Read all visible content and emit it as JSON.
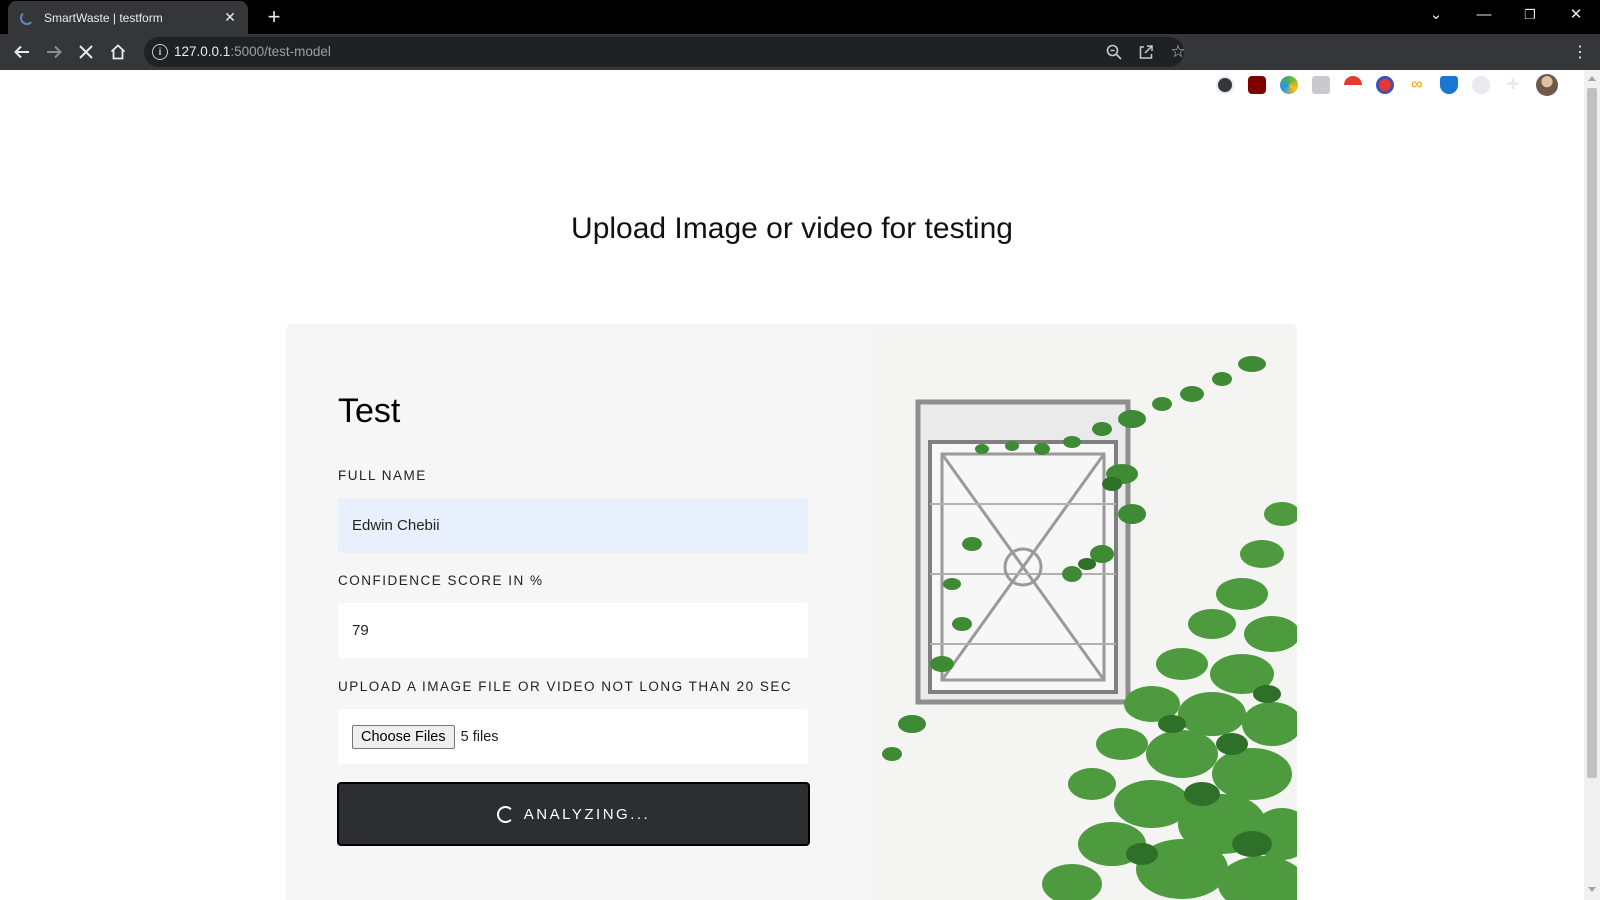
{
  "browser": {
    "tab_title": "SmartWaste | testform",
    "url_host": "127.0.0.1",
    "url_rest": ":5000/test-model"
  },
  "page": {
    "heading": "Upload Image or video for testing"
  },
  "form": {
    "title": "Test",
    "full_name_label": "FULL NAME",
    "full_name_value": "Edwin Chebii",
    "confidence_label": "CONFIDENCE SCORE IN %",
    "confidence_value": "79",
    "upload_label": "UPLOAD A IMAGE FILE OR VIDEO NOT LONG THAN 20 SEC",
    "choose_files_label": "Choose Files",
    "files_selected": "5 files",
    "submit_label": "ANALYZING..."
  },
  "icons": {
    "back": "arrow-left-icon",
    "forward": "arrow-right-icon",
    "stop": "close-icon",
    "home": "home-icon",
    "info": "info-icon",
    "zoom": "zoom-icon",
    "share": "share-icon",
    "bookmark": "star-icon",
    "extensions": "puzzle-icon",
    "menu": "kebab-menu-icon"
  },
  "colors": {
    "autofill_bg": "#e8f0fe",
    "button_bg": "#2d2e31",
    "card_bg": "#f6f6f6"
  }
}
